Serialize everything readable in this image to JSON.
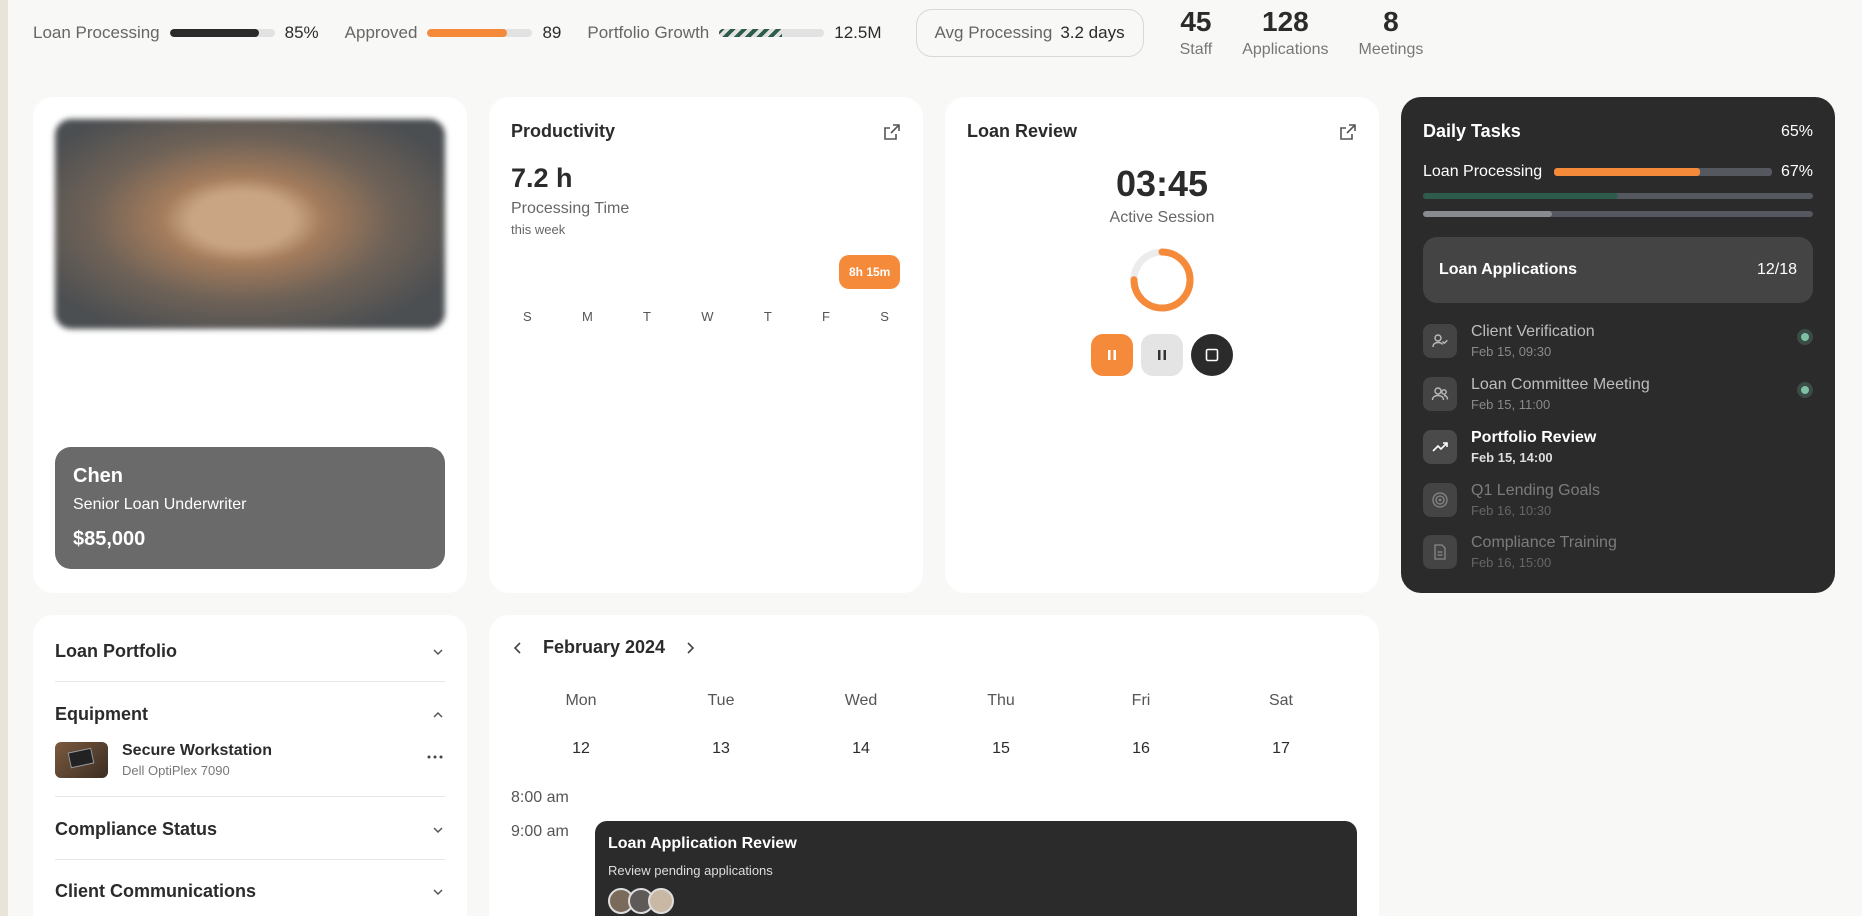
{
  "topbar": {
    "loan_processing": {
      "label": "Loan Processing",
      "value": "85%",
      "progress": 0.85
    },
    "approved": {
      "label": "Approved",
      "value": "89",
      "progress": 0.76
    },
    "portfolio_growth": {
      "label": "Portfolio Growth",
      "value": "12.5M",
      "progress": 0.6
    },
    "avg_processing": {
      "label": "Avg Processing",
      "value": "3.2 days"
    },
    "stats": [
      {
        "value": "45",
        "label": "Staff"
      },
      {
        "value": "128",
        "label": "Applications"
      },
      {
        "value": "8",
        "label": "Meetings"
      }
    ]
  },
  "profile": {
    "name": "Chen",
    "role": "Senior Loan Underwriter",
    "salary": "$85,000"
  },
  "productivity": {
    "title": "Productivity",
    "value": "7.2 h",
    "label": "Processing Time",
    "period": "this week",
    "badge": "8h 15m",
    "days": [
      "S",
      "M",
      "T",
      "W",
      "T",
      "F",
      "S"
    ]
  },
  "loan_review": {
    "title": "Loan Review",
    "timer": "03:45",
    "status": "Active Session",
    "progress": 0.75
  },
  "daily_tasks": {
    "title": "Daily Tasks",
    "percent": "65%",
    "loan_processing_label": "Loan Processing",
    "loan_processing_value": "67%",
    "loan_processing_progress": 0.67,
    "bar2_progress": 0.5,
    "bar3_progress": 0.33,
    "applications_label": "Loan Applications",
    "applications_value": "12/18",
    "tasks": [
      {
        "name": "Client Verification",
        "date": "Feb 15, 09:30",
        "icon": "user-check-icon"
      },
      {
        "name": "Loan Committee Meeting",
        "date": "Feb 15, 11:00",
        "icon": "users-icon"
      },
      {
        "name": "Portfolio Review",
        "date": "Feb 15, 14:00",
        "icon": "trending-up-icon"
      },
      {
        "name": "Q1 Lending Goals",
        "date": "Feb 16, 10:30",
        "icon": "target-icon"
      },
      {
        "name": "Compliance Training",
        "date": "Feb 16, 15:00",
        "icon": "document-icon"
      }
    ]
  },
  "accordion": {
    "loan_portfolio": "Loan Portfolio",
    "equipment": "Equipment",
    "equipment_item_name": "Secure Workstation",
    "equipment_item_model": "Dell OptiPlex 7090",
    "compliance": "Compliance Status",
    "communications": "Client Communications"
  },
  "calendar": {
    "month": "February 2024",
    "weekdays": [
      "Mon",
      "Tue",
      "Wed",
      "Thu",
      "Fri",
      "Sat"
    ],
    "dates": [
      "12",
      "13",
      "14",
      "15",
      "16",
      "17"
    ],
    "times": [
      "8:00 am",
      "9:00 am"
    ],
    "event_title": "Loan Application Review",
    "event_subtitle": "Review pending applications"
  }
}
